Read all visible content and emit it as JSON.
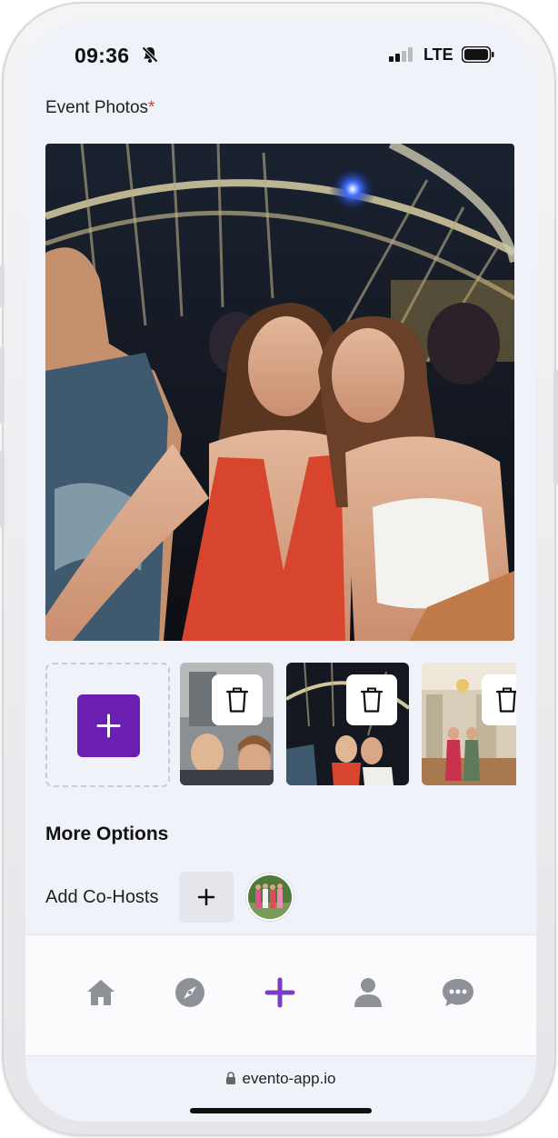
{
  "status_bar": {
    "time": "09:36",
    "network": "LTE"
  },
  "form": {
    "event_photos_label": "Event Photos",
    "required_marker": "*",
    "more_options_title": "More Options",
    "add_cohosts_label": "Add Co-Hosts",
    "add_icon": "+"
  },
  "tabs": [
    {
      "name": "home",
      "icon": "home-icon"
    },
    {
      "name": "explore",
      "icon": "compass-icon"
    },
    {
      "name": "create",
      "icon": "plus-icon",
      "active": true
    },
    {
      "name": "profile",
      "icon": "user-icon"
    },
    {
      "name": "messages",
      "icon": "chat-icon"
    }
  ],
  "browser": {
    "url": "evento-app.io"
  },
  "colors": {
    "accent": "#6a1fb0",
    "required": "#e03a3a",
    "tab_inactive": "#8e9197",
    "tab_active": "#7b3fc4"
  }
}
